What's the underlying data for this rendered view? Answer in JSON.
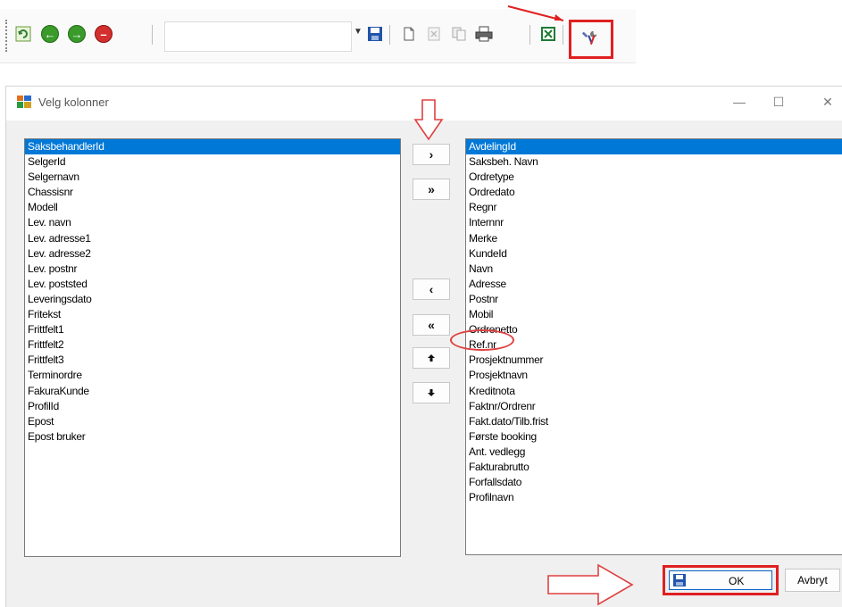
{
  "toolbar": {
    "combo_value": "",
    "icons": [
      "refresh-icon",
      "back-icon",
      "forward-icon",
      "stop-icon",
      "save-icon",
      "new-document-icon",
      "delete-icon",
      "copy-icon",
      "print-icon",
      "excel-icon",
      "tools-icon"
    ]
  },
  "dialog": {
    "title": "Velg kolonner",
    "minimize": "—",
    "maximize": "☐",
    "close": "✕"
  },
  "available_columns": [
    "SaksbehandlerId",
    "SelgerId",
    "Selgernavn",
    "Chassisnr",
    "Modell",
    "Lev. navn",
    "Lev. adresse1",
    "Lev. adresse2",
    "Lev. postnr",
    "Lev. poststed",
    "Leveringsdato",
    "Fritekst",
    "Frittfelt1",
    "Frittfelt2",
    "Frittfelt3",
    "Terminordre",
    "FakuraKunde",
    "ProfilId",
    "Epost",
    "Epost bruker"
  ],
  "selected_columns": [
    "AvdelingId",
    "Saksbeh. Navn",
    "Ordretype",
    "Ordredato",
    "Regnr",
    "Internnr",
    "Merke",
    "KundeId",
    "Navn",
    "Adresse",
    "Postnr",
    "Mobil",
    "Ordrenetto",
    "Ref.nr",
    "Prosjektnummer",
    "Prosjektnavn",
    "Kreditnota",
    "Faktnr/Ordrenr",
    "Fakt.dato/Tilb.frist",
    "Første booking",
    "Ant. vedlegg",
    "Fakturabrutto",
    "Forfallsdato",
    "Profilnavn"
  ],
  "buttons": {
    "add": "›",
    "add_all": "»",
    "remove": "‹",
    "remove_all": "«",
    "move_up": "🡅",
    "move_down": "🡇",
    "ok": "OK",
    "cancel": "Avbryt"
  },
  "colors": {
    "highlight": "#e02020",
    "selection": "#0078d7"
  }
}
